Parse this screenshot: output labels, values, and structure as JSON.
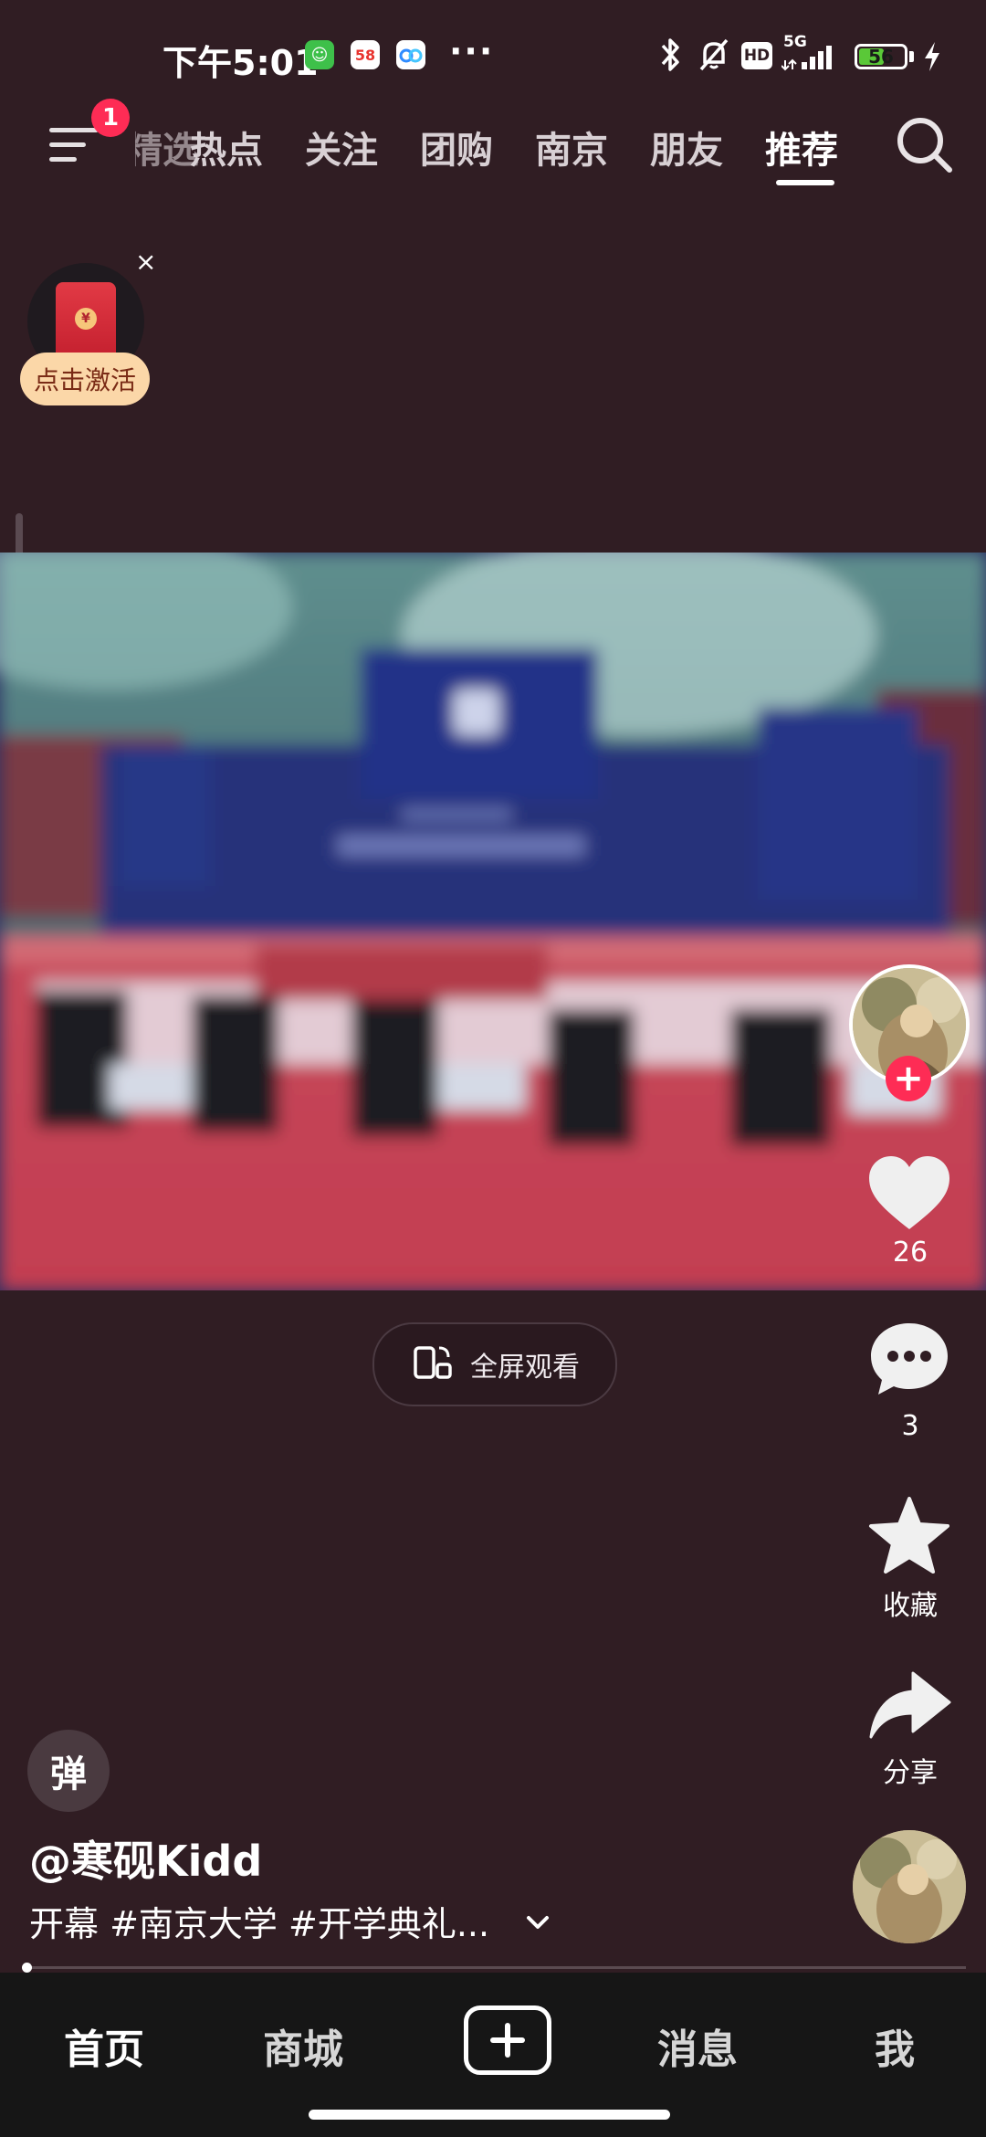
{
  "status_bar": {
    "time": "下午5:01",
    "app_icon_58_label": "58",
    "network_label": "5G",
    "hd_label": "HD",
    "battery_level": "56",
    "battery_fraction": 0.56,
    "more_indicator": "···"
  },
  "top_nav": {
    "notification_badge": "1",
    "tabs": [
      "精选",
      "热点",
      "关注",
      "团购",
      "南京",
      "朋友",
      "推荐"
    ],
    "active_tab": "推荐"
  },
  "red_packet": {
    "close_symbol": "×",
    "label": "点击激活"
  },
  "video": {
    "fullscreen_label": "全屏观看"
  },
  "actions": {
    "follow_symbol": "+",
    "like_count": "26",
    "comment_count": "3",
    "collect_label": "收藏",
    "share_label": "分享"
  },
  "caption": {
    "danmu_label": "弹",
    "author": "@寒砚Kidd",
    "description": "开幕 #南京大学 #开学典礼..."
  },
  "bottom_nav": {
    "home": "首页",
    "mall": "商城",
    "messages": "消息",
    "me": "我"
  },
  "colors": {
    "background": "#301d23",
    "accent": "#fe2c55",
    "bottom_bar": "#161616"
  },
  "icons": [
    "wechat-mini-icon",
    "58-app-icon",
    "baidu-pan-icon",
    "bluetooth-icon",
    "mute-bell-icon",
    "signal-icon",
    "battery-icon",
    "menu-icon",
    "search-icon",
    "red-envelope-icon",
    "rotate-phone-icon",
    "heart-icon",
    "comment-icon",
    "star-icon",
    "share-icon",
    "chevron-down-icon",
    "plus-icon"
  ]
}
